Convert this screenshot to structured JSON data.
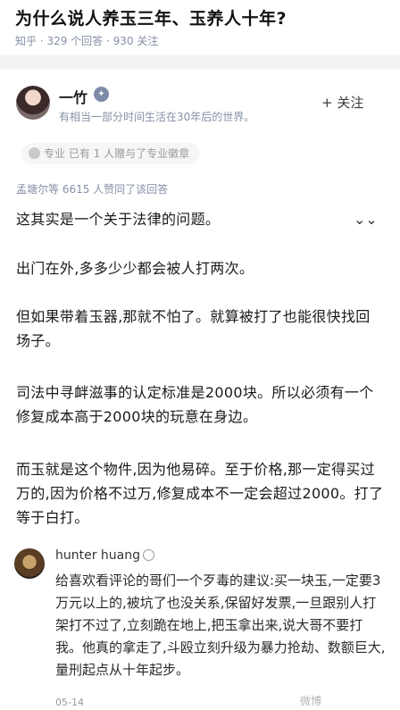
{
  "question": {
    "title": "为什么说人养玉三年、玉养人十年?",
    "meta": "知乎 · 329 个回答 · 930 关注"
  },
  "author": {
    "name": "一竹",
    "bio": "有相当一部分时间生活在30年后的世界。",
    "follow_label": "+ 关注",
    "tag": "专业 已有 1 人赠与了专业徽章"
  },
  "answer": {
    "votes": "孟塘尔等 6615 人赞同了该回答",
    "paragraphs": [
      "这其实是一个关于法律的问题。",
      "出门在外,多多少少都会被人打两次。",
      "但如果带着玉器,那就不怕了。就算被打了也能很快找回场子。",
      "司法中寻衅滋事的认定标准是2000块。所以必须有一个修复成本高于2000块的玩意在身边。",
      "而玉就是这个物件,因为他易碎。至于价格,那一定得买过万的,因为价格不过万,修复成本不一定会超过2000。打了等于白打。"
    ],
    "collapse_icon": "chevron-double-down"
  },
  "comment": {
    "author": "hunter huang",
    "text": "给喜欢看评论的哥们一个歹毒的建议:买一块玉,一定要3万元以上的,被坑了也没关系,保留好发票,一旦跟别人打架打不过了,立刻跪在地上,把玉拿出来,说大哥不要打我。他真的拿走了,斗殴立刻升级为暴力抢劫、数额巨大,量刑起点从十年起步。",
    "date": "05-14"
  },
  "watermark": "微博"
}
